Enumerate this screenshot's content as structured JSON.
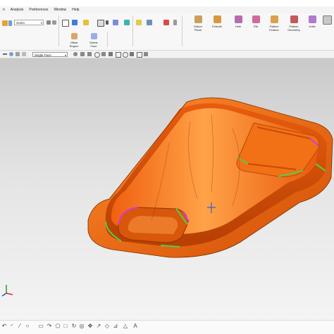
{
  "menu": [
    "n",
    "Analysis",
    "Preferences",
    "Window",
    "Help"
  ],
  "ribbon": {
    "search_value": "studio",
    "groups": {
      "offset_region": "Offset\nRegion",
      "delete_face": "Delete\nFace",
      "datum_plane": "Datum\nPlane",
      "extrude": "Extrude",
      "hole": "Hole",
      "rib": "Rib",
      "pattern_feature": "Pattern\nFeature",
      "pattern_geometry": "Pattern\nGeometry",
      "unite": "Unite"
    }
  },
  "selection_filter": "Single Face",
  "colors": {
    "part_fill": "#f06a10",
    "part_dark": "#c94a05",
    "part_light": "#ff9a3c",
    "edge_green": "#4fd04a",
    "edge_magenta": "#d23ad8",
    "viewport_top": "#c9c9c9",
    "viewport_bottom": "#f4f4f4"
  },
  "icons": [
    "save-icon",
    "undo-icon",
    "redo-icon",
    "select-icon",
    "zoom-icon",
    "rotate-icon",
    "view-triad-icon"
  ]
}
